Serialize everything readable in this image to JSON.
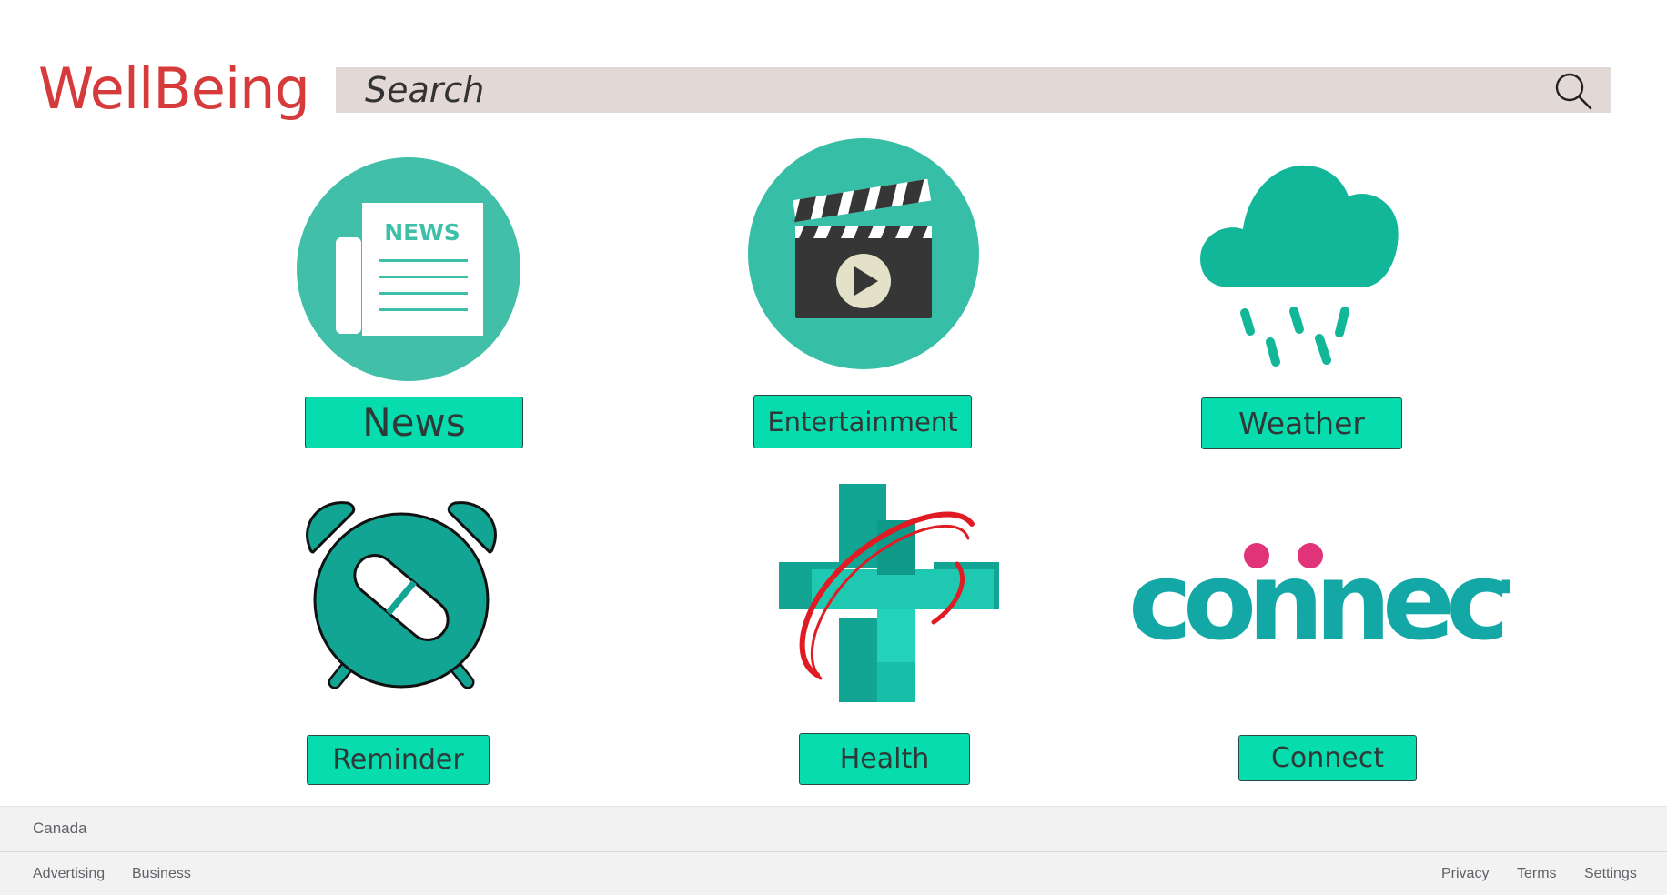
{
  "brand": {
    "name": "WellBeing",
    "color": "#d63a3a"
  },
  "search": {
    "placeholder": "Search",
    "icon": "search-icon"
  },
  "tiles": [
    {
      "label": "News",
      "icon": "newspaper-icon",
      "icon_text": "NEWS"
    },
    {
      "label": "Entertainment",
      "icon": "clapperboard-icon"
    },
    {
      "label": "Weather",
      "icon": "rain-cloud-icon"
    },
    {
      "label": "Reminder",
      "icon": "alarm-clock-pill-icon"
    },
    {
      "label": "Health",
      "icon": "medical-cross-icon"
    },
    {
      "label": "Connect",
      "icon": "connect-logo-icon",
      "icon_text": "connect"
    }
  ],
  "colors": {
    "teal_button": "#07dcae",
    "teal_icon": "#3dbfa8",
    "teal_dark": "#13a593",
    "footer_bg": "#f2f2f2"
  },
  "footer": {
    "country": "Canada",
    "left_links": [
      "Advertising",
      "Business"
    ],
    "right_links": [
      "Privacy",
      "Terms",
      "Settings"
    ]
  }
}
